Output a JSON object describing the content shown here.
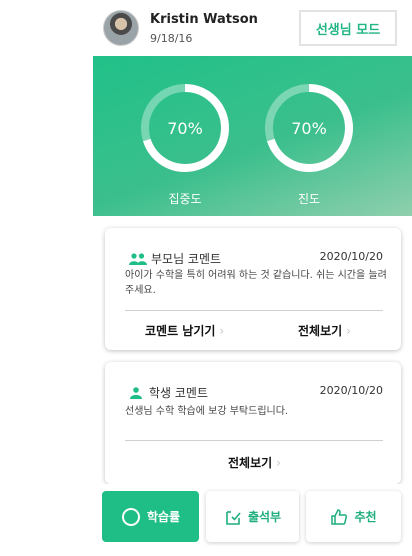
{
  "header": {
    "user_name": "Kristin Watson",
    "date": "9/18/16",
    "teacher_mode_label": "선생님 모드"
  },
  "stats": [
    {
      "value_label": "70%",
      "value": 0.7,
      "label": "집중도"
    },
    {
      "value_label": "70%",
      "value": 0.7,
      "label": "진도"
    }
  ],
  "parent_comment": {
    "title": "부모님 코멘트",
    "date": "2020/10/20",
    "text": "아이가 수학을 특히 어려워 하는 것 같습니다. 쉬는 시간을 늘려주세요.",
    "leave_comment_label": "코멘트 남기기",
    "view_all_label": "전체보기"
  },
  "student_comment": {
    "title": "학생 코멘트",
    "date": "2020/10/20",
    "text": "선생님 수학 학습에 보강 부탁드립니다.",
    "view_all_label": "전체보기"
  },
  "bottom_nav": {
    "items": [
      {
        "label": "학습률",
        "icon": "circle-icon"
      },
      {
        "label": "출석부",
        "icon": "attendance-icon"
      },
      {
        "label": "추천",
        "icon": "thumbs-up-icon"
      }
    ]
  },
  "colors": {
    "accent": "#1fbe86",
    "hero_gradient_start": "#21c189",
    "hero_gradient_end": "#8fcfae"
  }
}
